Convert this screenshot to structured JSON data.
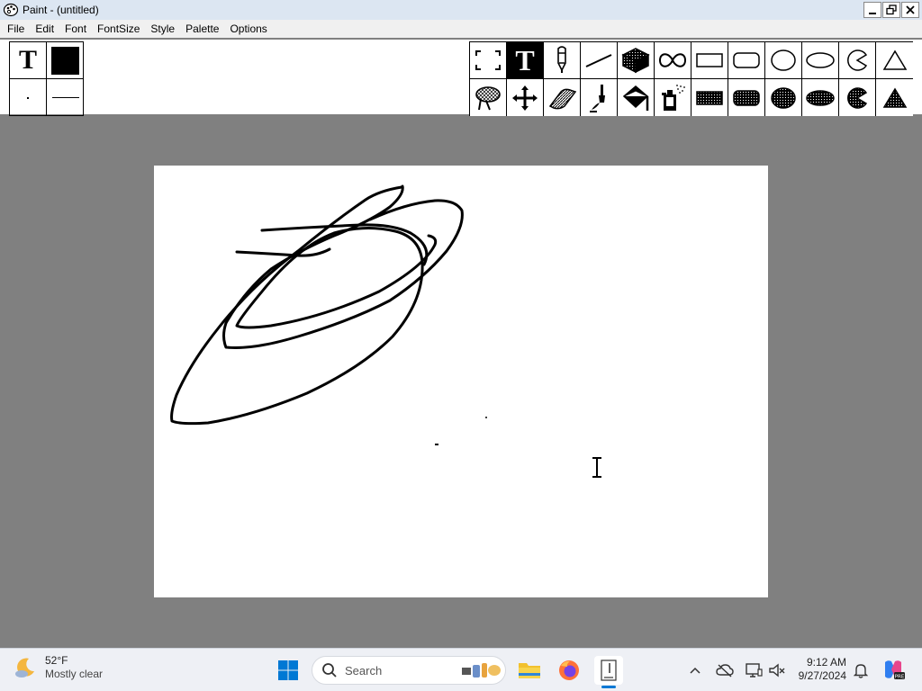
{
  "window": {
    "title": "Paint - (untitled)"
  },
  "menu": [
    "File",
    "Edit",
    "Font",
    "FontSize",
    "Style",
    "Palette",
    "Options"
  ],
  "attributes": {
    "text_glyph": "T",
    "foreground_color": "#000000"
  },
  "tools": {
    "text_glyph": "T",
    "active_tool": "text-tool"
  },
  "taskbar": {
    "weather_temp": "52°F",
    "weather_desc": "Mostly clear",
    "search_label": "Search",
    "time": "9:12 AM",
    "date": "9/27/2024"
  },
  "colors": {
    "workspace": "#808080",
    "canvas": "#ffffff",
    "titlebar": "#dce6f2",
    "taskbar": "#eef0f5",
    "windows_blue": "#0078d4"
  }
}
